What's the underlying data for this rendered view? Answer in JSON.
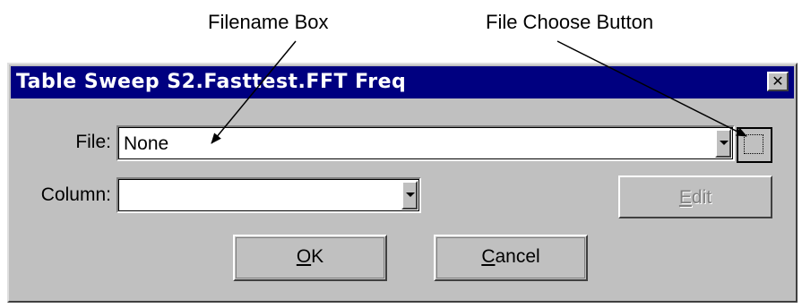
{
  "callouts": {
    "filename_box": "Filename Box",
    "file_choose_button": "File Choose Button"
  },
  "dialog": {
    "title": "Table Sweep S2.Fasttest.FFT Freq",
    "close_glyph": "✕",
    "file_label": "File:",
    "file_value": "None",
    "column_label": "Column:",
    "column_value": "",
    "edit_button": {
      "mnemonic": "E",
      "rest": "dit",
      "enabled": false
    },
    "ok_button": {
      "mnemonic": "O",
      "rest": "K"
    },
    "cancel_button": {
      "mnemonic": "C",
      "rest": "ancel"
    }
  },
  "icons": {
    "close": "close-icon",
    "dropdown": "chevron-down-icon",
    "file_choose": "file-browse-icon"
  },
  "colors": {
    "titlebar": "#000080",
    "dialog_face": "#c0c0c0",
    "disabled_text": "#808080"
  }
}
